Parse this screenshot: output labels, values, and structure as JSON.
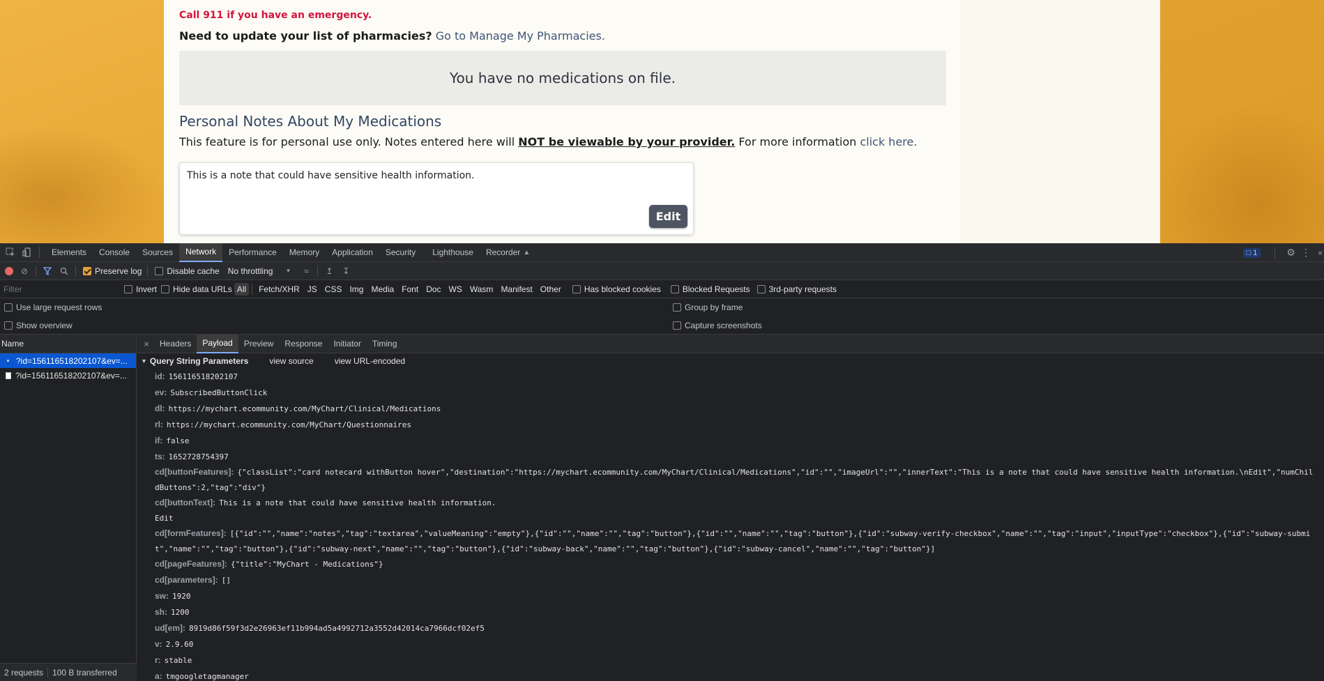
{
  "page": {
    "emergency": "Call 911 if you have an emergency.",
    "pharmacy_question": "Need to update your list of pharmacies?",
    "pharmacy_link": "Go to Manage My Pharmacies.",
    "no_meds": "You have no medications on file.",
    "notes_title": "Personal Notes About My Medications",
    "notes_desc_prefix": "This feature is for personal use only. Notes entered here will",
    "notes_desc_emph": "NOT be viewable by your provider.",
    "notes_desc_middle": "For more information",
    "notes_desc_link": "click here.",
    "note_text": "This is a note that could have sensitive health information.",
    "edit_label": "Edit"
  },
  "devtools": {
    "tabs": [
      "Elements",
      "Console",
      "Sources",
      "Network",
      "Performance",
      "Memory",
      "Application",
      "Security",
      "Lighthouse",
      "Recorder"
    ],
    "active_tab": "Network",
    "issues_count": "1",
    "toolbar": {
      "preserve_log": "Preserve log",
      "disable_cache": "Disable cache",
      "throttling": "No throttling"
    },
    "filter": {
      "placeholder": "Filter",
      "invert": "Invert",
      "hide_data_urls": "Hide data URLs",
      "types": [
        "All",
        "Fetch/XHR",
        "JS",
        "CSS",
        "Img",
        "Media",
        "Font",
        "Doc",
        "WS",
        "Wasm",
        "Manifest",
        "Other"
      ],
      "has_blocked_cookies": "Has blocked cookies",
      "blocked_requests": "Blocked Requests",
      "third_party": "3rd-party requests"
    },
    "settings": {
      "large_rows": "Use large request rows",
      "group_by_frame": "Group by frame",
      "show_overview": "Show overview",
      "capture_screenshots": "Capture screenshots"
    },
    "name_header": "Name",
    "requests": [
      "?id=156116518202107&ev=...",
      "?id=156116518202107&ev=..."
    ],
    "status": {
      "requests": "2 requests",
      "transferred": "100 B transferred"
    },
    "detail_tabs": [
      "Headers",
      "Payload",
      "Preview",
      "Response",
      "Initiator",
      "Timing"
    ],
    "active_detail_tab": "Payload",
    "qsp_title": "Query String Parameters",
    "view_source": "view source",
    "view_url_encoded": "view URL-encoded",
    "params": [
      {
        "k": "id:",
        "v": "156116518202107"
      },
      {
        "k": "ev:",
        "v": "SubscribedButtonClick"
      },
      {
        "k": "dl:",
        "v": "https://mychart.ecommunity.com/MyChart/Clinical/Medications"
      },
      {
        "k": "rl:",
        "v": "https://mychart.ecommunity.com/MyChart/Questionnaires"
      },
      {
        "k": "if:",
        "v": "false"
      },
      {
        "k": "ts:",
        "v": "1652728754397"
      },
      {
        "k": "cd[buttonFeatures]:",
        "v": "{\"classList\":\"card notecard withButton hover\",\"destination\":\"https://mychart.ecommunity.com/MyChart/Clinical/Medications\",\"id\":\"\",\"imageUrl\":\"\",\"innerText\":\"This is a note that could have sensitive health information.\\nEdit\",\"numChildButtons\":2,\"tag\":\"div\"}"
      },
      {
        "k": "cd[buttonText]:",
        "v": "This is a note that could have sensitive health information."
      },
      {
        "k": "",
        "v": "Edit"
      },
      {
        "k": "cd[formFeatures]:",
        "v": "[{\"id\":\"\",\"name\":\"notes\",\"tag\":\"textarea\",\"valueMeaning\":\"empty\"},{\"id\":\"\",\"name\":\"\",\"tag\":\"button\"},{\"id\":\"\",\"name\":\"\",\"tag\":\"button\"},{\"id\":\"subway-verify-checkbox\",\"name\":\"\",\"tag\":\"input\",\"inputType\":\"checkbox\"},{\"id\":\"subway-submit\",\"name\":\"\",\"tag\":\"button\"},{\"id\":\"subway-next\",\"name\":\"\",\"tag\":\"button\"},{\"id\":\"subway-back\",\"name\":\"\",\"tag\":\"button\"},{\"id\":\"subway-cancel\",\"name\":\"\",\"tag\":\"button\"}]"
      },
      {
        "k": "cd[pageFeatures]:",
        "v": "{\"title\":\"MyChart - Medications\"}"
      },
      {
        "k": "cd[parameters]:",
        "v": "[]"
      },
      {
        "k": "sw:",
        "v": "1920"
      },
      {
        "k": "sh:",
        "v": "1200"
      },
      {
        "k": "ud[em]:",
        "v": "8919d86f59f3d2e26963ef11b994ad5a4992712a3552d42014ca7966dcf02ef5"
      },
      {
        "k": "v:",
        "v": "2.9.60"
      },
      {
        "k": "r:",
        "v": "stable"
      },
      {
        "k": "a:",
        "v": "tmgoogletagmanager"
      }
    ]
  }
}
